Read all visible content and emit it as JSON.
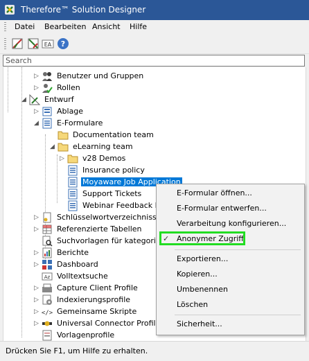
{
  "window": {
    "title": "Therefore™ Solution Designer"
  },
  "menu": [
    "Datei",
    "Bearbeiten",
    "Ansicht",
    "Hilfe"
  ],
  "toolbar": [
    {
      "icon": "design-icon"
    },
    {
      "icon": "deploy-icon"
    },
    {
      "icon": "font-icon",
      "label": "EA"
    },
    {
      "icon": "help-icon",
      "label": "?"
    }
  ],
  "search": {
    "placeholder": "Search"
  },
  "tree": [
    {
      "label": "Benutzer und Gruppen",
      "icon": "users-icon"
    },
    {
      "label": "Rollen",
      "icon": "roles-icon"
    },
    {
      "label": "Entwurf",
      "icon": "design-root-icon"
    },
    {
      "label": "Ablage",
      "icon": "storage-icon"
    },
    {
      "label": "E-Formulare",
      "icon": "eform-icon"
    },
    {
      "label": "Documentation team",
      "icon": "folder-icon"
    },
    {
      "label": "eLearning team",
      "icon": "folder-icon"
    },
    {
      "label": "v28 Demos",
      "icon": "folder-icon"
    },
    {
      "label": "Insurance policy",
      "icon": "form-icon"
    },
    {
      "label": "Moyaware Job Application",
      "icon": "form-icon"
    },
    {
      "label": "Support Tickets",
      "icon": "form-icon"
    },
    {
      "label": "Webinar Feedback Form",
      "icon": "form-icon"
    },
    {
      "label": "Schlüsselwortverzeichnisse",
      "icon": "keyword-icon"
    },
    {
      "label": "Referenzierte Tabellen",
      "icon": "table-icon"
    },
    {
      "label": "Suchvorlagen für kategorieübergreifende Suche",
      "icon": "search-template-icon"
    },
    {
      "label": "Berichte",
      "icon": "report-icon"
    },
    {
      "label": "Dashboard",
      "icon": "dashboard-icon"
    },
    {
      "label": "Volltextsuche",
      "icon": "fulltext-icon"
    },
    {
      "label": "Capture Client Profile",
      "icon": "capture-icon"
    },
    {
      "label": "Indexierungsprofile",
      "icon": "indexing-icon"
    },
    {
      "label": "Gemeinsame Skripte",
      "icon": "script-icon"
    },
    {
      "label": "Universal Connector Profile",
      "icon": "connector-icon"
    },
    {
      "label": "Vorlagenprofile",
      "icon": "template-icon"
    }
  ],
  "context_menu": {
    "items": [
      {
        "label": "E-Formular öffnen..."
      },
      {
        "label": "E-Formular entwerfen..."
      },
      {
        "label": "Verarbeitung konfigurieren..."
      },
      {
        "label": "Anonymer Zugriff",
        "checked": true,
        "highlighted": true
      },
      {
        "label": "Exportieren..."
      },
      {
        "label": "Kopieren..."
      },
      {
        "label": "Umbenennen"
      },
      {
        "label": "Löschen"
      },
      {
        "label": "Sicherheit..."
      }
    ],
    "check_glyph": "✓"
  },
  "status": {
    "text": "Drücken Sie F1, um Hilfe zu erhalten."
  },
  "colors": {
    "titlebar": "#2b5797",
    "selection": "#0078d7",
    "highlight_box": "#22dd22"
  }
}
